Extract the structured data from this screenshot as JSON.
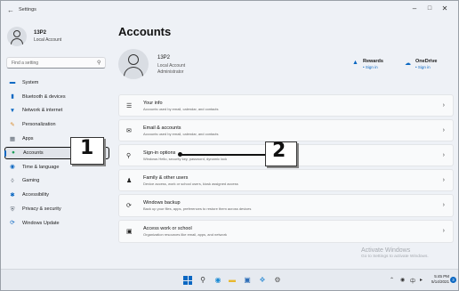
{
  "window": {
    "title": "Settings",
    "back_icon": "back-arrow-icon",
    "controls": [
      "minimize",
      "maximize",
      "close"
    ]
  },
  "user": {
    "name": "13P2",
    "type": "Local Account",
    "role": "Administrator"
  },
  "search": {
    "placeholder": "Find a setting"
  },
  "sidebar": {
    "items": [
      {
        "label": "System",
        "icon": "monitor-icon",
        "active": false
      },
      {
        "label": "Bluetooth & devices",
        "icon": "bluetooth-icon",
        "active": false
      },
      {
        "label": "Network & internet",
        "icon": "wifi-icon",
        "active": false
      },
      {
        "label": "Personalization",
        "icon": "brush-icon",
        "active": false
      },
      {
        "label": "Apps",
        "icon": "apps-icon",
        "active": false
      },
      {
        "label": "Accounts",
        "icon": "person-icon",
        "active": true
      },
      {
        "label": "Time & language",
        "icon": "globe-clock-icon",
        "active": false
      },
      {
        "label": "Gaming",
        "icon": "gamepad-icon",
        "active": false
      },
      {
        "label": "Accessibility",
        "icon": "accessibility-icon",
        "active": false
      },
      {
        "label": "Privacy & security",
        "icon": "shield-icon",
        "active": false
      },
      {
        "label": "Windows Update",
        "icon": "update-icon",
        "active": false
      }
    ]
  },
  "main": {
    "title": "Accounts",
    "quicklinks": [
      {
        "title": "Rewards",
        "sub": "• Sign in",
        "icon": "rewards-icon"
      },
      {
        "title": "OneDrive",
        "sub": "• Sign in",
        "icon": "cloud-icon"
      }
    ],
    "cards": [
      {
        "title": "Your info",
        "sub": "Accounts used by email, calendar, and contacts",
        "icon": "person-card-icon"
      },
      {
        "title": "Email & accounts",
        "sub": "Accounts used by email, calendar, and contacts",
        "icon": "mail-icon"
      },
      {
        "title": "Sign-in options",
        "sub": "Windows Hello, security key, password, dynamic lock",
        "icon": "key-icon"
      },
      {
        "title": "Family & other users",
        "sub": "Device access, work or school users, kiosk assigned access",
        "icon": "family-icon"
      },
      {
        "title": "Windows backup",
        "sub": "Back up your files, apps, preferences to restore them across devices",
        "icon": "backup-icon"
      },
      {
        "title": "Access work or school",
        "sub": "Organization resources like email, apps, and network",
        "icon": "briefcase-icon"
      }
    ]
  },
  "annotations": {
    "one": "1",
    "two": "2"
  },
  "watermark": {
    "title": "Activate Windows",
    "sub": "Go to Settings to activate Windows."
  },
  "taskbar": {
    "time": "5:45 PM",
    "date": "5/14/2021",
    "notifications": "3",
    "tray_lang": "中"
  },
  "colors": {
    "accent": "#0a67c2",
    "background": "#eef1f6",
    "card": "#f9fafb"
  }
}
